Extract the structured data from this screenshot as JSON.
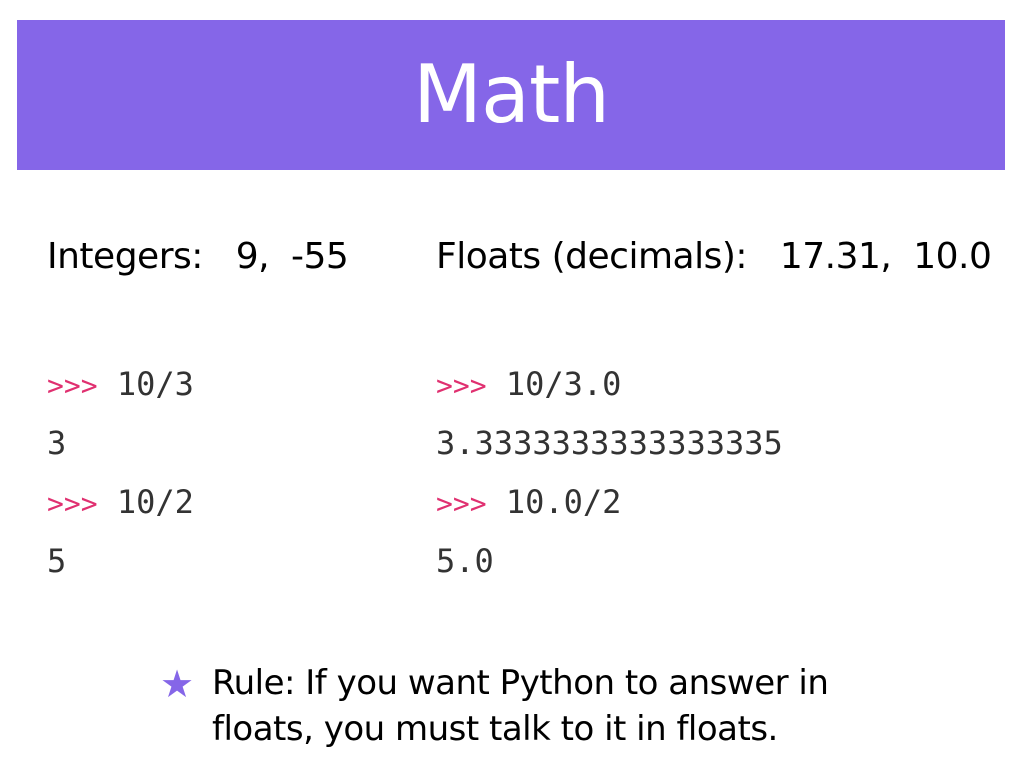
{
  "title": "Math",
  "integers": {
    "heading": "Integers:   9,  -55",
    "lines": [
      {
        "prompt": ">>>",
        "code": "10/3"
      },
      {
        "prompt": "",
        "code": "3"
      },
      {
        "prompt": ">>>",
        "code": "10/2"
      },
      {
        "prompt": "",
        "code": "5"
      }
    ]
  },
  "floats": {
    "heading": "Floats (decimals):   17.31,  10.0",
    "lines": [
      {
        "prompt": ">>>",
        "code": "10/3.0"
      },
      {
        "prompt": "",
        "code": "3.3333333333333335"
      },
      {
        "prompt": ">>>",
        "code": "10.0/2"
      },
      {
        "prompt": "",
        "code": "5.0"
      }
    ]
  },
  "rule": {
    "icon": "star-icon",
    "line1": "Rule: If you want Python to answer in",
    "line2": "floats, you must talk to it in floats."
  },
  "colors": {
    "title_bar": "#8566E8",
    "prompt": "#E03070",
    "star": "#8566E8"
  }
}
